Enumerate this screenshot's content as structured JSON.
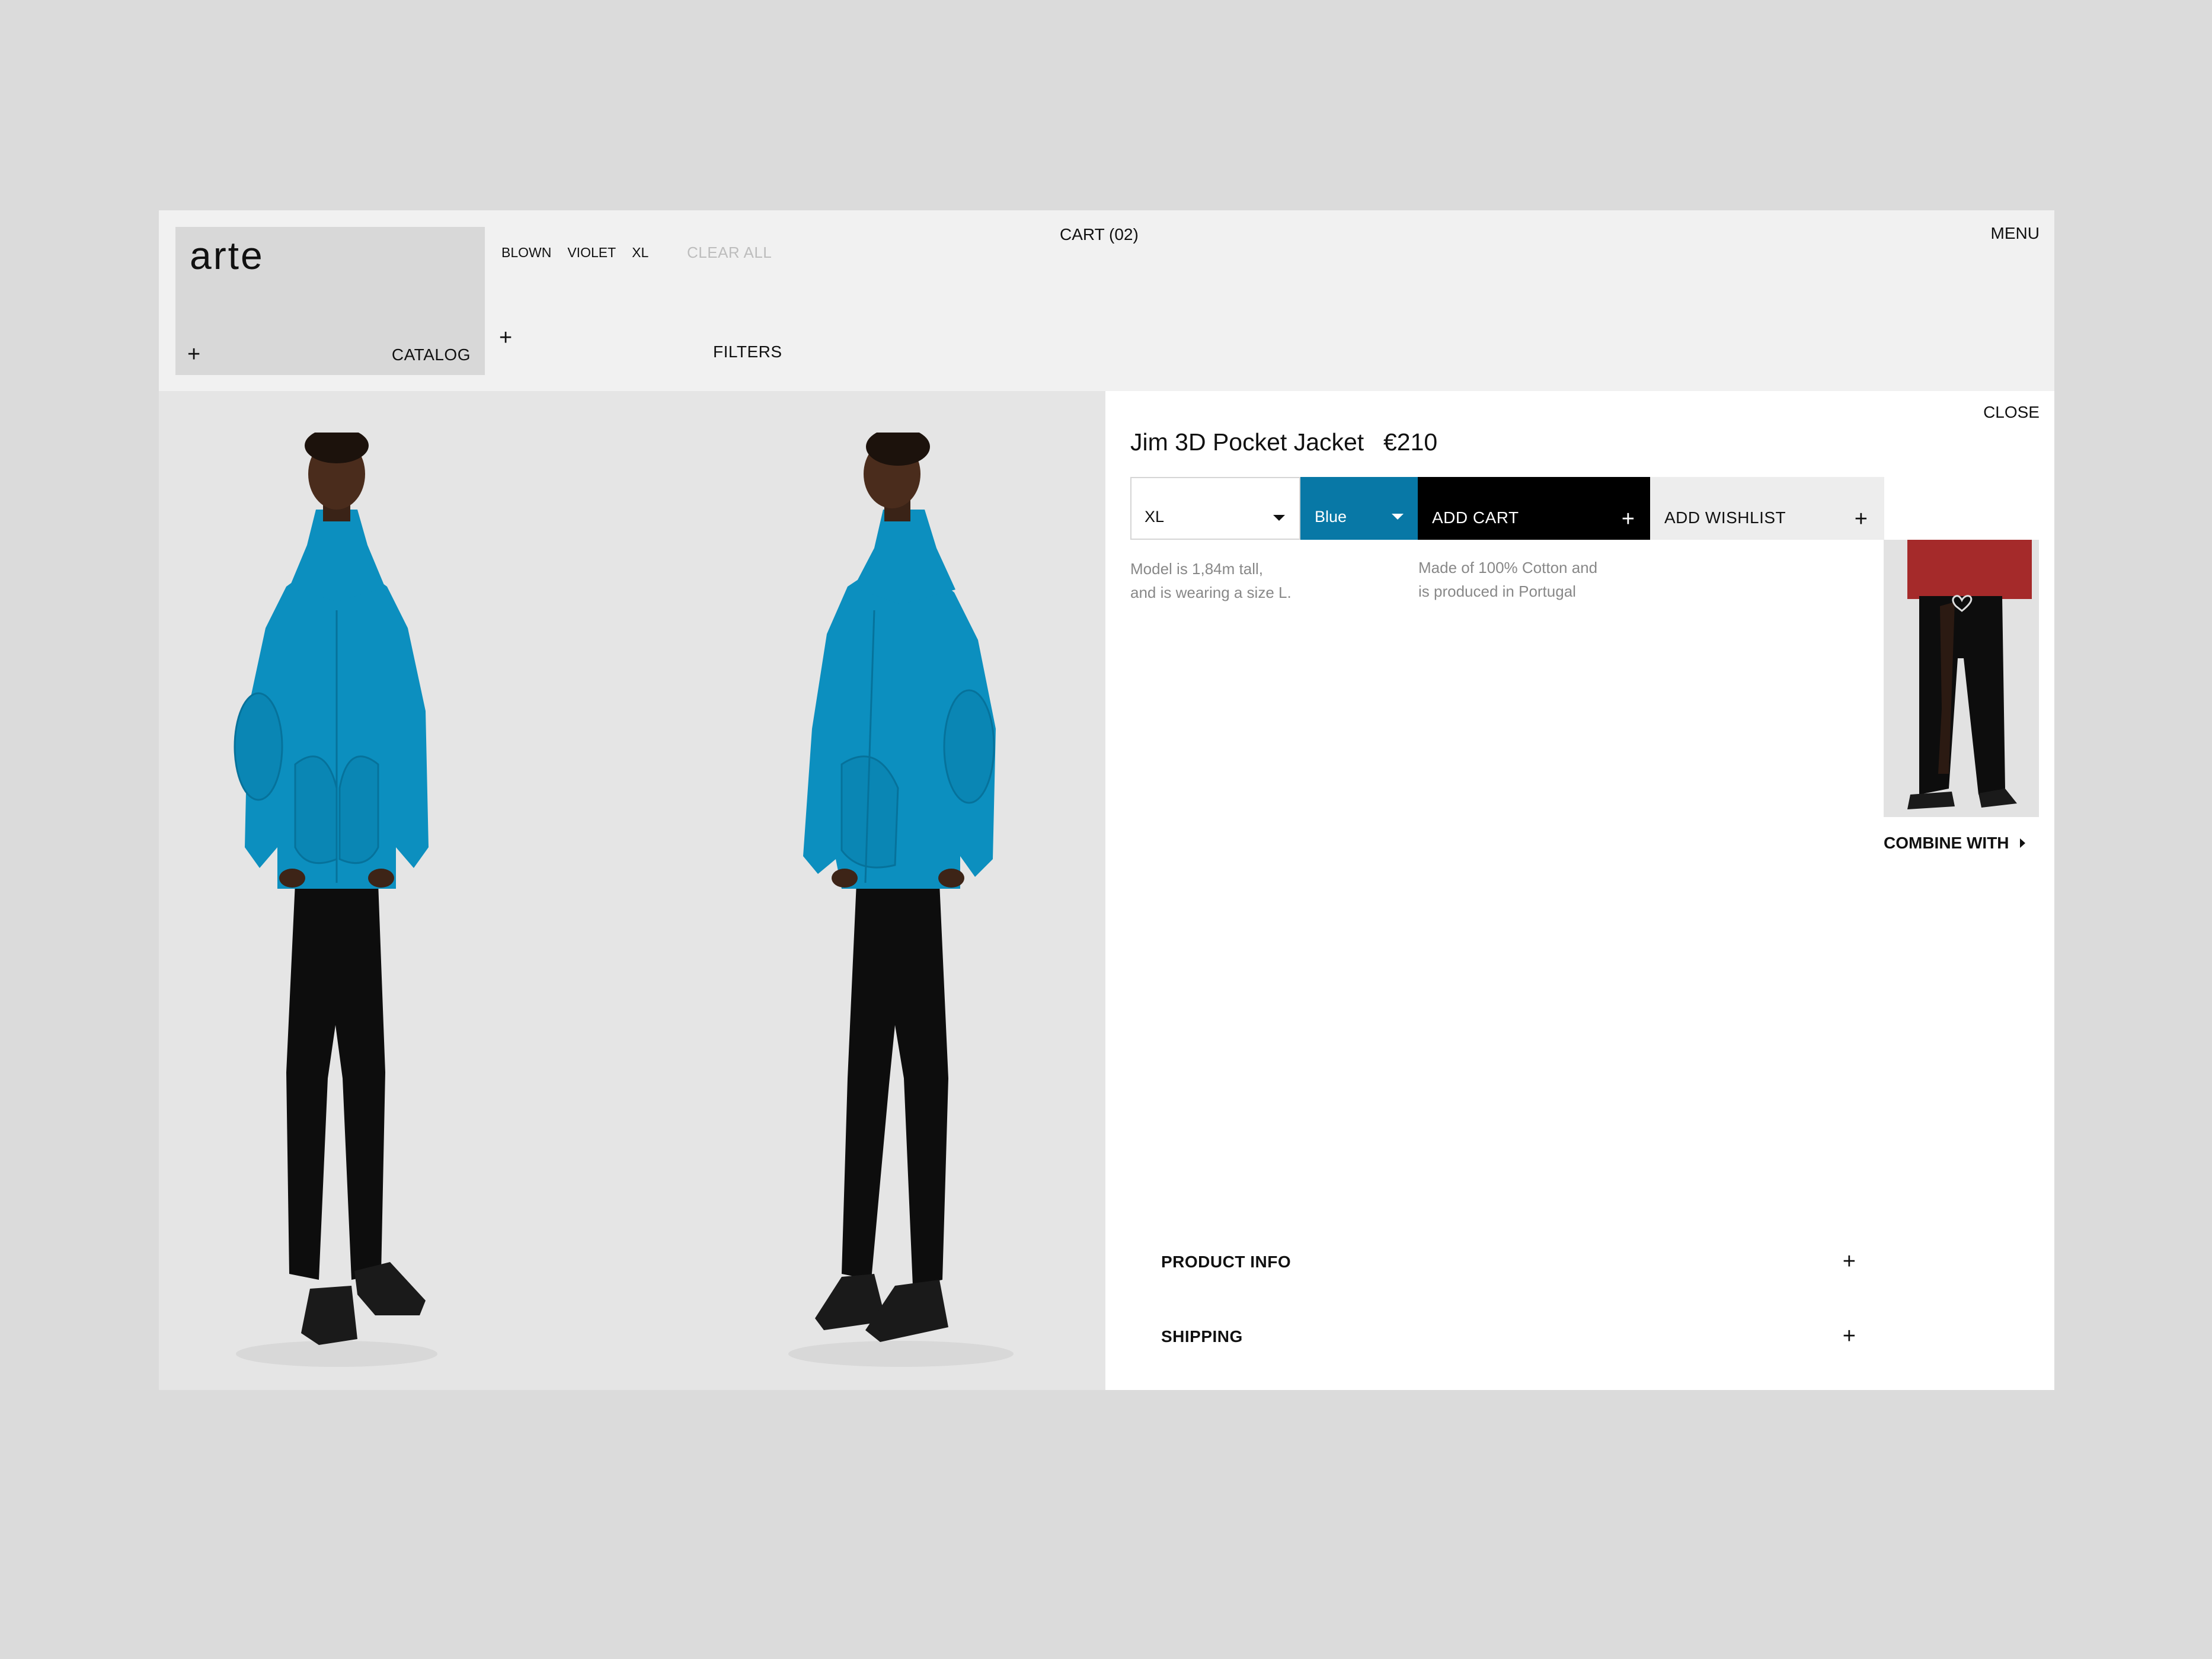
{
  "header": {
    "logo": "arte",
    "catalog_label": "CATALOG",
    "filters_label": "FILTERS",
    "active_filters": [
      "BLOWN",
      "VIOLET",
      "XL"
    ],
    "clear_all_label": "CLEAR ALL",
    "cart_label": "CART (02)",
    "menu_label": "MENU",
    "plus_glyph": "+"
  },
  "product": {
    "close_label": "CLOSE",
    "title": "Jim 3D Pocket Jacket",
    "price": "€210",
    "size_value": "XL",
    "color_value": "Blue",
    "color_hex": "#0878a6",
    "add_cart_label": "ADD CART",
    "add_wishlist_label": "ADD WISHLIST",
    "model_note": [
      "Model is 1,84m tall,",
      "and is wearing a size L."
    ],
    "material_note": [
      "Made of 100% Cotton and",
      "is produced in Portugal"
    ],
    "combine_label": "COMBINE WITH",
    "accordions": [
      {
        "label": "PRODUCT INFO"
      },
      {
        "label": "SHIPPING"
      }
    ]
  },
  "colors": {
    "frame_bg": "#f1f1f1",
    "page_bg": "#dbdbdb",
    "accent_blue": "#0878a6"
  }
}
